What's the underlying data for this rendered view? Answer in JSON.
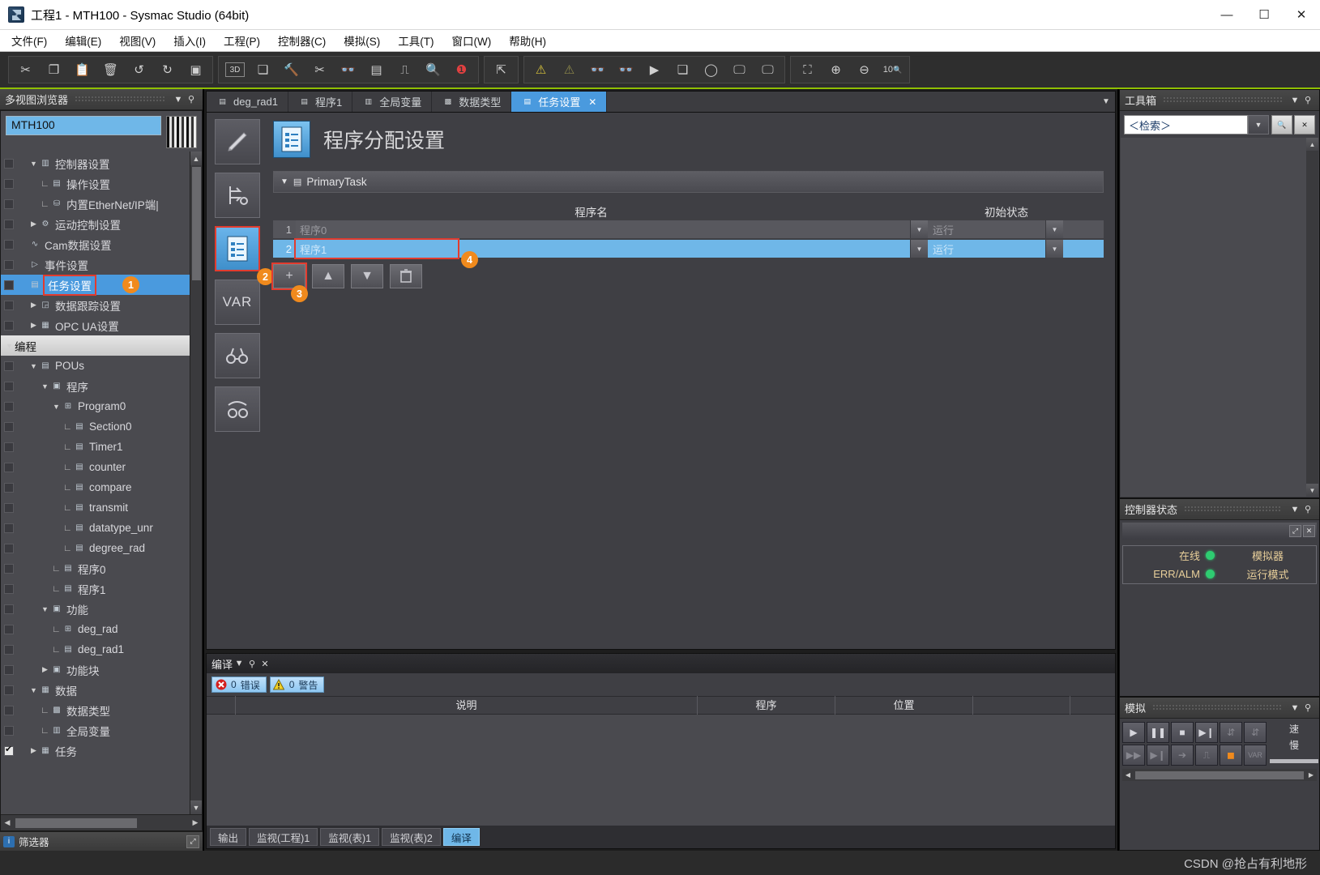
{
  "window": {
    "title": "工程1 - MTH100 - Sysmac Studio (64bit)",
    "minimize": "—",
    "maximize": "☐",
    "close": "✕"
  },
  "menubar": [
    {
      "label": "文件(F)"
    },
    {
      "label": "编辑(E)"
    },
    {
      "label": "视图(V)"
    },
    {
      "label": "插入(I)"
    },
    {
      "label": "工程(P)"
    },
    {
      "label": "控制器(C)"
    },
    {
      "label": "模拟(S)"
    },
    {
      "label": "工具(T)"
    },
    {
      "label": "窗口(W)"
    },
    {
      "label": "帮助(H)"
    }
  ],
  "toolbar": {
    "group1": [
      "cut-icon",
      "copy-icon",
      "paste-icon",
      "delete-icon",
      "undo-icon",
      "redo-icon",
      "help-paste-icon"
    ],
    "group2": [
      "3d-view-icon",
      "project-window-icon",
      "build-icon",
      "rebuild-icon",
      "offline-compare-icon",
      "table-compare-icon",
      "monitor-icon",
      "search-icon",
      "troubleshoot-icon"
    ],
    "group3": [
      "sync-transfer-icon"
    ],
    "group4": [
      "warning-icon",
      "warning-off-icon",
      "monitor-glasses-icon",
      "monitor-stop-icon",
      "transfer-to-controller-icon",
      "transfer-from-controller-icon",
      "online-icon",
      "simulator-start-icon",
      "simulator-stop-icon"
    ],
    "group5": [
      "fit-window-icon",
      "zoom-in-icon",
      "zoom-out-icon",
      "zoom-ratio-icon"
    ]
  },
  "multiview": {
    "title": "多视图浏览器",
    "collapse": "▼",
    "pin": "⚲",
    "device_name": "MTH100",
    "tree": [
      {
        "label": "控制器设置",
        "indent": 1,
        "arrow": "▼",
        "icon": "controller-icon",
        "box": true
      },
      {
        "label": "操作设置",
        "indent": 2,
        "leaf": "∟",
        "icon": "operation-icon",
        "box": true
      },
      {
        "label": "内置EtherNet/IP端|",
        "indent": 2,
        "leaf": "∟",
        "icon": "ethernet-icon",
        "box": true
      },
      {
        "label": "运动控制设置",
        "indent": 1,
        "arrow": "▶",
        "icon": "gear-icon",
        "box": true
      },
      {
        "label": "Cam数据设置",
        "indent": 1,
        "icon": "cam-icon",
        "box": true
      },
      {
        "label": "事件设置",
        "indent": 1,
        "icon": "event-icon",
        "box": true
      },
      {
        "label": "任务设置",
        "indent": 1,
        "icon": "task-icon",
        "box": true,
        "selected": true,
        "highlight": true,
        "badge": "1"
      },
      {
        "label": "数据跟踪设置",
        "indent": 1,
        "arrow": "▶",
        "icon": "trace-icon",
        "box": true
      },
      {
        "label": "OPC UA设置",
        "indent": 1,
        "arrow": "▶",
        "icon": "opcua-icon",
        "box": true
      },
      {
        "label": "编程",
        "indent": 0,
        "arrow": "▼",
        "header": true
      },
      {
        "label": "POUs",
        "indent": 1,
        "arrow": "▼",
        "icon": "pou-icon",
        "box": true
      },
      {
        "label": "程序",
        "indent": 2,
        "arrow": "▼",
        "icon": "programs-icon",
        "box": true
      },
      {
        "label": "Program0",
        "indent": 3,
        "arrow": "▼",
        "icon": "program-icon",
        "box": true
      },
      {
        "label": "Section0",
        "indent": 4,
        "leaf": "∟",
        "icon": "section-icon",
        "box": true
      },
      {
        "label": "Timer1",
        "indent": 4,
        "leaf": "∟",
        "icon": "section-icon",
        "box": true
      },
      {
        "label": "counter",
        "indent": 4,
        "leaf": "∟",
        "icon": "section-icon",
        "box": true
      },
      {
        "label": "compare",
        "indent": 4,
        "leaf": "∟",
        "icon": "section-icon",
        "box": true
      },
      {
        "label": "transmit",
        "indent": 4,
        "leaf": "∟",
        "icon": "section-icon",
        "box": true
      },
      {
        "label": "datatype_unr",
        "indent": 4,
        "leaf": "∟",
        "icon": "section-icon",
        "box": true
      },
      {
        "label": "degree_rad",
        "indent": 4,
        "leaf": "∟",
        "icon": "section-icon",
        "box": true
      },
      {
        "label": "程序0",
        "indent": 3,
        "leaf": "∟",
        "icon": "prog-doc-icon",
        "box": true
      },
      {
        "label": "程序1",
        "indent": 3,
        "leaf": "∟",
        "icon": "prog-doc-icon",
        "box": true
      },
      {
        "label": "功能",
        "indent": 2,
        "arrow": "▼",
        "icon": "function-icon",
        "box": true
      },
      {
        "label": "deg_rad",
        "indent": 3,
        "leaf": "∟",
        "icon": "program-icon",
        "box": true
      },
      {
        "label": "deg_rad1",
        "indent": 3,
        "leaf": "∟",
        "icon": "prog-doc-icon",
        "box": true
      },
      {
        "label": "功能块",
        "indent": 2,
        "arrow": "▶",
        "icon": "fb-icon",
        "box": true
      },
      {
        "label": "数据",
        "indent": 1,
        "arrow": "▼",
        "icon": "data-icon",
        "box": true
      },
      {
        "label": "数据类型",
        "indent": 2,
        "leaf": "∟",
        "icon": "datatype-icon",
        "box": true
      },
      {
        "label": "全局变量",
        "indent": 2,
        "leaf": "∟",
        "icon": "var-icon",
        "box": true
      },
      {
        "label": "任务",
        "indent": 1,
        "arrow": "▶",
        "icon": "tasks-icon",
        "box": true,
        "checked": true
      }
    ],
    "filter": {
      "label": "筛选器",
      "icon": "info-icon",
      "expand": "⤢"
    }
  },
  "editor": {
    "tabs": [
      {
        "label": "deg_rad1",
        "icon": "prog-doc-icon",
        "active": false
      },
      {
        "label": "程序1",
        "icon": "prog-doc-icon",
        "active": false
      },
      {
        "label": "全局变量",
        "icon": "var-icon",
        "active": false
      },
      {
        "label": "数据类型",
        "icon": "datatype-icon",
        "active": false
      },
      {
        "label": "任务设置",
        "icon": "task-icon",
        "active": true,
        "close": "✕"
      }
    ],
    "tab_overflow": "▼",
    "side_buttons": [
      {
        "name": "edit-pencil-icon",
        "selected": false
      },
      {
        "name": "task-io-icon",
        "selected": false
      },
      {
        "name": "program-assign-icon",
        "selected": true,
        "badge": "2"
      },
      {
        "name": "variable-icon",
        "selected": false,
        "label": "VAR"
      },
      {
        "name": "access-glasses-icon",
        "selected": false
      },
      {
        "name": "exclusive-control-icon",
        "selected": false
      }
    ],
    "page_title": "程序分配设置",
    "page_icon": "program-assign-icon",
    "task_group": {
      "name": "PrimaryTask",
      "collapse": "▼",
      "icon": "folder-icon"
    },
    "columns": {
      "program_name": "程序名",
      "initial_state": "初始状态"
    },
    "rows": [
      {
        "index": "1",
        "program": "程序0",
        "state": "运行",
        "selected": false
      },
      {
        "index": "2",
        "program": "程序1",
        "state": "运行",
        "selected": true,
        "highlight": true,
        "badge": "4"
      }
    ],
    "row_buttons": [
      {
        "name": "add-row-button",
        "glyph": "+",
        "highlight": true,
        "badge": "3"
      },
      {
        "name": "move-up-button",
        "glyph": "▲"
      },
      {
        "name": "move-down-button",
        "glyph": "▼"
      },
      {
        "name": "delete-row-button",
        "glyph": "🗑"
      }
    ]
  },
  "compile_panel": {
    "title": "编译",
    "collapse": "▼",
    "pin": "⚲",
    "close": "✕",
    "errors": {
      "count": "0",
      "label": "错误",
      "icon": "error-icon"
    },
    "warnings": {
      "count": "0",
      "label": "警告",
      "icon": "warning-icon"
    },
    "columns": [
      "",
      "说明",
      "程序",
      "位置",
      ""
    ],
    "tabs": [
      {
        "label": "输出",
        "active": false
      },
      {
        "label": "监视(工程)1",
        "active": false
      },
      {
        "label": "监视(表)1",
        "active": false
      },
      {
        "label": "监视(表)2",
        "active": false
      },
      {
        "label": "编译",
        "active": true
      }
    ]
  },
  "toolbox": {
    "title": "工具箱",
    "collapse": "▼",
    "pin": "⚲",
    "search_value": "＜检索＞",
    "search_dropdown": "▼",
    "search_button": "search-icon",
    "close_button": "✕"
  },
  "controller_status": {
    "title": "控制器状态",
    "collapse": "▼",
    "pin": "⚲",
    "expand_button": "⤢",
    "close_button": "✕",
    "rows": [
      {
        "label": "在线",
        "led": "green",
        "right": "模拟器"
      },
      {
        "label": "ERR/ALM",
        "led": "green",
        "right": "运行模式"
      }
    ],
    "led_color": "#2ecc71"
  },
  "simulation": {
    "title": "模拟",
    "collapse": "▼",
    "pin": "⚲",
    "buttons_row1": [
      "run-icon",
      "pause-icon",
      "stop-icon",
      "step-in-icon",
      "step-over-icon",
      "step-out-icon"
    ],
    "buttons_row2": [
      "run-fast-icon",
      "next-icon",
      "continue-icon",
      "scan-icon",
      "breakpoint-icon",
      "var-icon"
    ],
    "speed_fast": "速",
    "speed_slow": "慢"
  },
  "watermark": "CSDN @抢占有利地形",
  "colors": {
    "accent_blue": "#4a9ade",
    "row_blue": "#6fb7e8",
    "highlight_red": "#e23b2e",
    "badge_orange": "#f08a1d",
    "toolbar_underline": "#8fbf00",
    "led_green": "#2ecc71"
  }
}
